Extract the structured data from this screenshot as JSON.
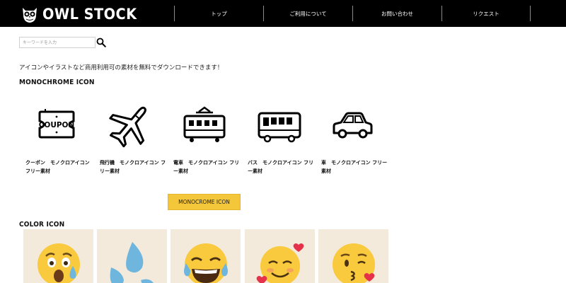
{
  "header": {
    "logo_text": "OWL STOCK",
    "nav": [
      "トップ",
      "ご利用について",
      "お問い合わせ",
      "リクエスト"
    ]
  },
  "search": {
    "placeholder": "キーワードを入力",
    "icon": "search-icon"
  },
  "tagline": "アイコンやイラストなど商用利用可の素材を無料でダウンロードできます！",
  "mono_section": {
    "title": "MONOCHROME ICON",
    "items": [
      {
        "icon": "coupon-icon",
        "icon_text": "COUPON",
        "label": "クーポン　モノクロアイコン フリー素材"
      },
      {
        "icon": "airplane-icon",
        "label": "飛行機　モノクロアイコン フリー素材"
      },
      {
        "icon": "train-icon",
        "label": "電車　モノクロアイコン フリー素材"
      },
      {
        "icon": "bus-icon",
        "label": "バス　モノクロアイコン フリー素材"
      },
      {
        "icon": "car-icon",
        "label": "車　モノクロアイコン フリー素材"
      }
    ],
    "button_label": "MONOCROME ICON"
  },
  "color_section": {
    "title": "COLOR ICON",
    "items": [
      {
        "icon": "shocked-sweat-emoji-icon"
      },
      {
        "icon": "sweat-droplets-icon"
      },
      {
        "icon": "tears-of-joy-emoji-icon"
      },
      {
        "icon": "smiling-hearts-emoji-icon"
      },
      {
        "icon": "kissing-heart-emoji-icon"
      }
    ]
  },
  "colors": {
    "header_bg": "#000000",
    "accent_yellow": "#f4c63a",
    "card_bg": "#f3eadb",
    "emoji_yellow": "#f9c93e",
    "heart_red": "#e5324a",
    "drop_blue": "#6fb6de"
  }
}
